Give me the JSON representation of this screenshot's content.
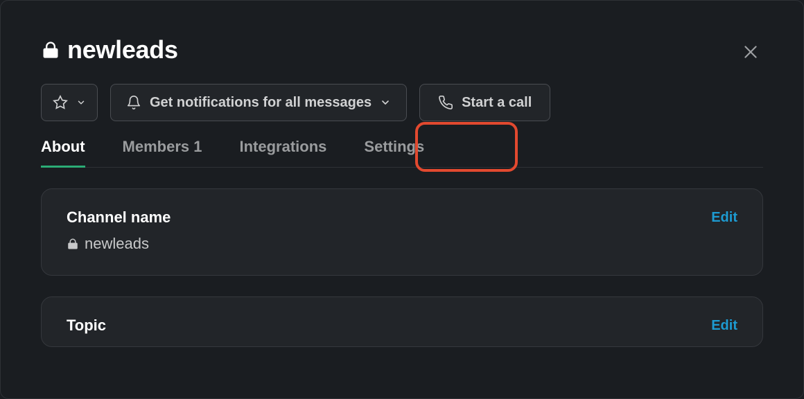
{
  "header": {
    "channel_name": "newleads"
  },
  "actions": {
    "notifications_label": "Get notifications for all messages",
    "call_label": "Start a call"
  },
  "tabs": {
    "about": "About",
    "members_label": "Members",
    "members_count": "1",
    "integrations": "Integrations",
    "settings": "Settings"
  },
  "cards": {
    "channel_name": {
      "title": "Channel name",
      "value": "newleads",
      "edit": "Edit"
    },
    "topic": {
      "title": "Topic",
      "edit": "Edit"
    }
  }
}
